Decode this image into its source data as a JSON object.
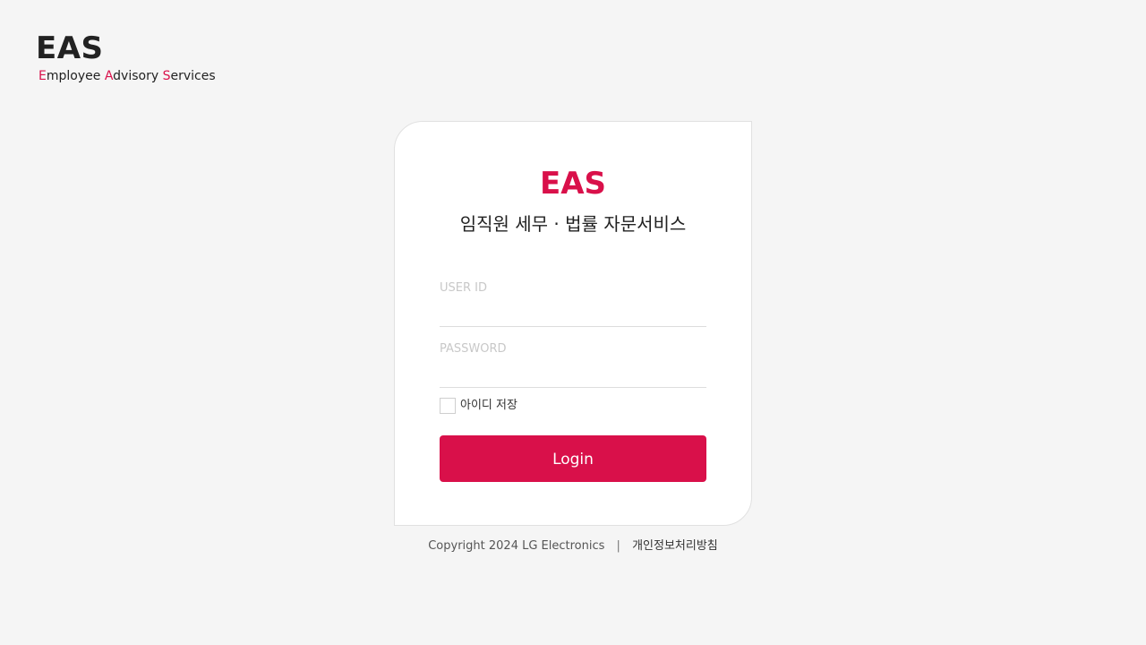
{
  "brand": {
    "title": "EAS",
    "subtitle_parts": [
      {
        "text": "E",
        "highlight": true
      },
      {
        "text": "mployee ",
        "highlight": false
      },
      {
        "text": "A",
        "highlight": true
      },
      {
        "text": "dvisory ",
        "highlight": false
      },
      {
        "text": "S",
        "highlight": true
      },
      {
        "text": "ervices",
        "highlight": false
      }
    ]
  },
  "login": {
    "title": "EAS",
    "subtitle": "임직원 세무 · 법률 자문서비스",
    "user_id_label": "USER ID",
    "user_id_value": "",
    "password_label": "PASSWORD",
    "password_value": "",
    "remember_label": "아이디 저장",
    "remember_checked": false,
    "button_label": "Login"
  },
  "footer": {
    "copyright": "Copyright 2024 LG Electronics",
    "separator": "|",
    "privacy_link": "개인정보처리방침"
  },
  "colors": {
    "accent": "#d9104a",
    "background": "#f5f5f5",
    "card": "#ffffff",
    "text": "#222222"
  }
}
